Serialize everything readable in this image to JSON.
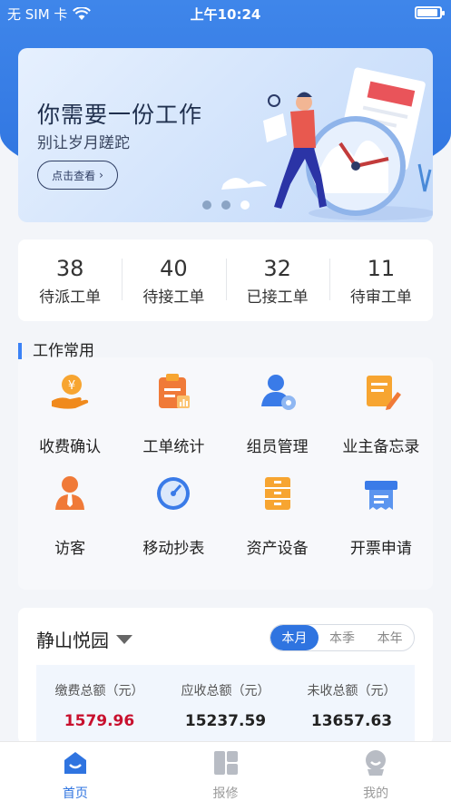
{
  "status_bar": {
    "carrier": "无 SIM 卡",
    "time": "上午10:24",
    "battery_level": 0.9
  },
  "banner": {
    "title": "你需要一份工作",
    "subtitle": "别让岁月蹉跎",
    "button_label": "点击查看",
    "page_count": 3,
    "active_page": 3
  },
  "stats": [
    {
      "value": "38",
      "label": "待派工单"
    },
    {
      "value": "40",
      "label": "待接工单"
    },
    {
      "value": "32",
      "label": "已接工单"
    },
    {
      "value": "11",
      "label": "待审工单"
    }
  ],
  "work": {
    "title": "工作常用",
    "items": [
      {
        "label": "收费确认",
        "icon": "coin-hand-icon"
      },
      {
        "label": "工单统计",
        "icon": "clipboard-chart-icon"
      },
      {
        "label": "组员管理",
        "icon": "user-gear-icon"
      },
      {
        "label": "业主备忘录",
        "icon": "memo-pen-icon"
      },
      {
        "label": "访客",
        "icon": "visitor-icon"
      },
      {
        "label": "移动抄表",
        "icon": "meter-gauge-icon"
      },
      {
        "label": "资产设备",
        "icon": "cabinet-icon"
      },
      {
        "label": "开票申请",
        "icon": "invoice-printer-icon"
      }
    ]
  },
  "summary": {
    "project": "静山悦园",
    "periods": [
      "本月",
      "本季",
      "本年"
    ],
    "selected_period": "本月",
    "totals": [
      {
        "label": "缴费总额（元）",
        "value": "1579.96"
      },
      {
        "label": "应收总额（元）",
        "value": "15237.59"
      },
      {
        "label": "未收总额（元）",
        "value": "13657.63"
      }
    ]
  },
  "tabs": [
    {
      "label": "首页",
      "icon": "home-icon",
      "active": true
    },
    {
      "label": "报修",
      "icon": "repair-icon",
      "active": false
    },
    {
      "label": "我的",
      "icon": "profile-icon",
      "active": false
    }
  ],
  "colors": {
    "primary": "#2f74e0",
    "highlight_value": "#c8102e",
    "icon_orange": "#f39a2c"
  }
}
